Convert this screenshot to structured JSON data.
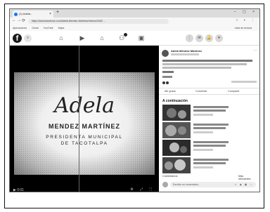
{
  "browser": {
    "tab_title": "(1) Adela...",
    "tab_close": "×",
    "new_tab": "+",
    "window_controls": "– ▢ ×",
    "back": "←",
    "forward": "→",
    "reload": "⟳",
    "url": "https://www.facebook.com/Adela.Mendez.Martinez/videos/1842 ...",
    "bookmarks": [
      "Aplicaciones",
      "Gmail",
      "YouTube",
      "Maps"
    ],
    "bookmarks_right": "Lista de lectura"
  },
  "facebook": {
    "logo": "f",
    "search_icon": "⌕",
    "nav_icons": [
      "home-icon",
      "video-icon",
      "marketplace-icon",
      "groups-icon",
      "gaming-icon"
    ],
    "nav_glyphs": [
      "⌂",
      "▶",
      "⌂",
      "⚇",
      "▣"
    ],
    "right_icons": [
      "menu-icon",
      "messenger-icon",
      "notifications-icon",
      "account-icon"
    ],
    "right_glyphs": [
      "⋮",
      "✉",
      "🔔",
      "▾"
    ]
  },
  "video": {
    "name": "Adela",
    "surname": "MENDEZ MARTÍNEZ",
    "role_line1": "PRESIDENTA MUNICIPAL",
    "role_line2": "DE TACOTALPA",
    "controls_left": "▶ 0:01",
    "controls_right": "⚙ ⤢ ⛶"
  },
  "post": {
    "author": "Adela Méndez Martínez",
    "more": "···",
    "actions": [
      "Me gusta",
      "Comentar",
      "Compartir"
    ]
  },
  "sidebar": {
    "continue_title": "A continuación"
  },
  "comments": {
    "label": "Comentarios",
    "sort": "Más relevantes",
    "placeholder": "Escribe un comentario...",
    "emoji_glyphs": "☺ ◉ ▣ ☆"
  },
  "colors": {
    "accent": "#1877f2",
    "video_bg": "#000000"
  }
}
